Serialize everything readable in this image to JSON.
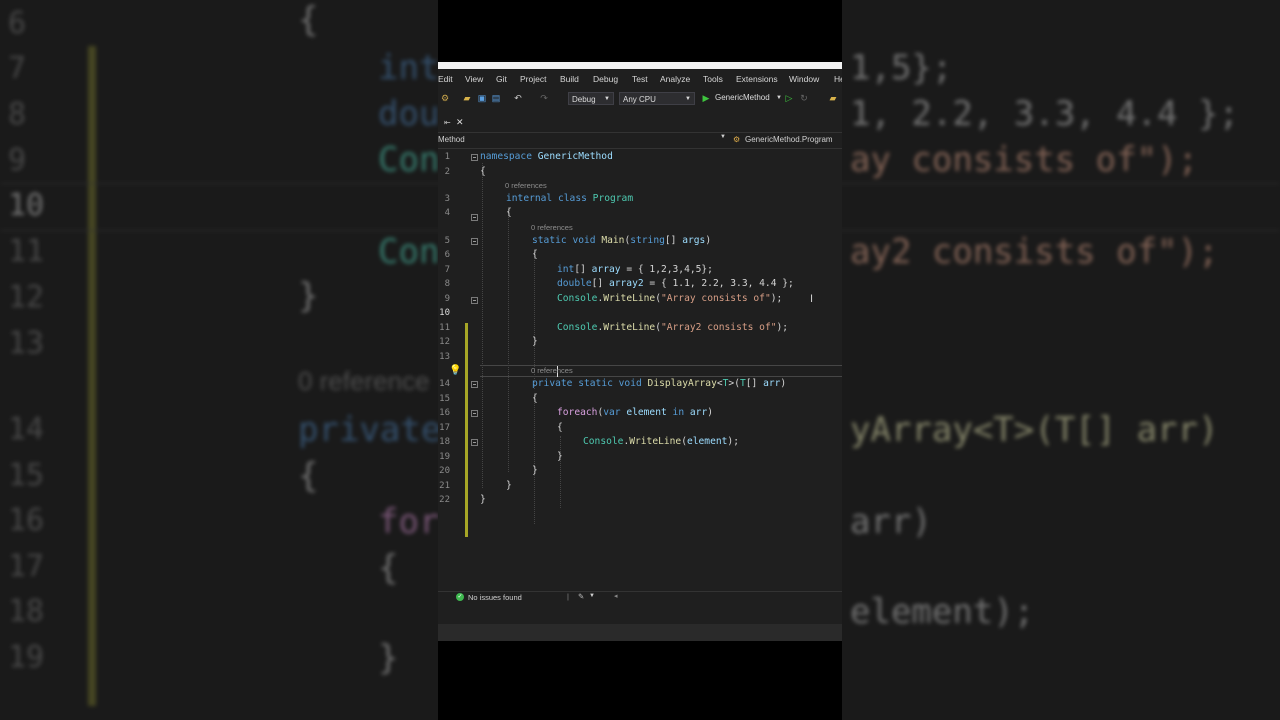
{
  "background": {
    "lines": [
      {
        "n": "6",
        "text": "{"
      },
      {
        "n": "7",
        "text": "int"
      },
      {
        "n": "8",
        "text": "dou"
      },
      {
        "n": "9",
        "text": "Con"
      },
      {
        "n": "10",
        "text": ""
      },
      {
        "n": "11",
        "text": "Con"
      },
      {
        "n": "12",
        "text": "}"
      },
      {
        "n": "13",
        "text": ""
      },
      {
        "n": "14",
        "text": "private"
      },
      {
        "n": "15",
        "text": "{"
      },
      {
        "n": "16",
        "text": "for"
      },
      {
        "n": "17",
        "text": "{"
      },
      {
        "n": "18",
        "text": ""
      },
      {
        "n": "19",
        "text": "}"
      }
    ],
    "right_lines": [
      "1,5};",
      "1, 2.2, 3.3, 4.4 };",
      "ay consists of\");",
      "ay2 consists of\");",
      "yArray<T>(T[] arr)",
      "arr)",
      "element);"
    ],
    "ref_text": "0 reference"
  },
  "menu": {
    "items": [
      "Edit",
      "View",
      "Git",
      "Project",
      "Build",
      "Debug",
      "Test",
      "Analyze",
      "Tools",
      "Extensions",
      "Window",
      "He"
    ]
  },
  "toolbar": {
    "config": "Debug",
    "platform": "Any CPU",
    "run_target": "GenericMethod"
  },
  "navbar": {
    "left": "Method",
    "right": "GenericMethod.Program"
  },
  "references_label": "0 references",
  "code_lines": [
    {
      "n": "1",
      "text": "namespace GenericMethod"
    },
    {
      "n": "2",
      "text": "{"
    },
    {
      "n": "3",
      "text": "internal class Program"
    },
    {
      "n": "4",
      "text": "{"
    },
    {
      "n": "5",
      "text": "static void Main(string[] args)"
    },
    {
      "n": "6",
      "text": "{"
    },
    {
      "n": "7",
      "text": "int[] array = { 1,2,3,4,5};"
    },
    {
      "n": "8",
      "text": "double[] array2 = { 1.1, 2.2, 3.3, 4.4 };"
    },
    {
      "n": "9",
      "text": "Console.WriteLine(\"Array consists of\");"
    },
    {
      "n": "10",
      "text": ""
    },
    {
      "n": "11",
      "text": "Console.WriteLine(\"Array2 consists of\");"
    },
    {
      "n": "12",
      "text": "}"
    },
    {
      "n": "13",
      "text": ""
    },
    {
      "n": "14",
      "text": "private static void DisplayArray<T>(T[] arr)"
    },
    {
      "n": "15",
      "text": "{"
    },
    {
      "n": "16",
      "text": "foreach(var element in arr)"
    },
    {
      "n": "17",
      "text": "{"
    },
    {
      "n": "18",
      "text": "Console.WriteLine(element);"
    },
    {
      "n": "19",
      "text": "}"
    },
    {
      "n": "20",
      "text": "}"
    },
    {
      "n": "21",
      "text": "}"
    },
    {
      "n": "22",
      "text": "}"
    }
  ],
  "status": {
    "issues": "No issues found"
  }
}
